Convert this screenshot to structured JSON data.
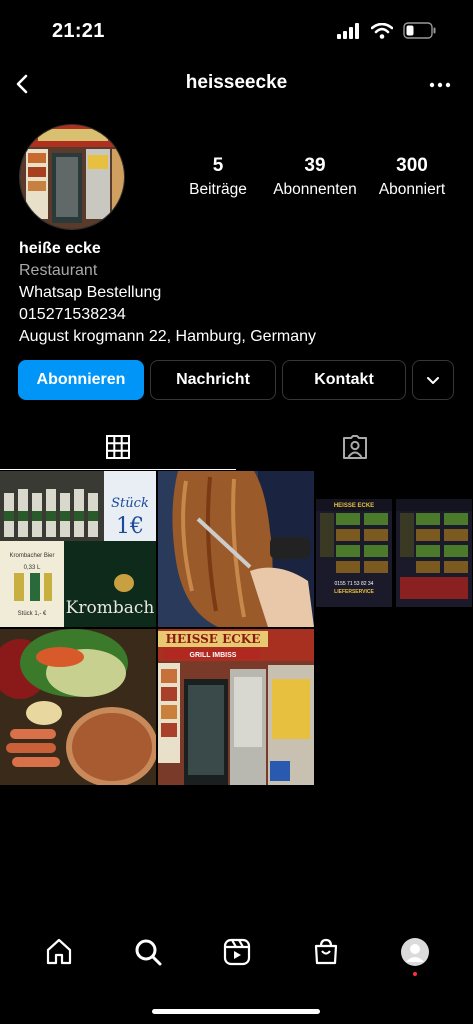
{
  "status": {
    "time": "21:21"
  },
  "header": {
    "username": "heisseecke"
  },
  "stats": [
    {
      "num": "5",
      "label": "Beiträge"
    },
    {
      "num": "39",
      "label": "Abonnenten"
    },
    {
      "num": "300",
      "label": "Abonniert"
    }
  ],
  "bio": {
    "name": "heiße ecke",
    "category": "Restaurant",
    "lines": [
      "Whatsap Bestellung",
      "015271538234",
      "August krogmann 22, Hamburg, Germany"
    ]
  },
  "buttons": {
    "follow": "Abonnieren",
    "message": "Nachricht",
    "contact": "Kontakt"
  },
  "posts": {
    "p1_sign": "Stück\n1€",
    "p1_brand": "Krombach",
    "p1_menu": "Krombacher Bier",
    "p1_price": "0,33 L",
    "p1_price2": "Stück 1,- €",
    "p3_title": "HEISSE ECKE",
    "p3_sub": "GRILL IMBISS",
    "p3_delivery": "LIEFERSERVICE",
    "p3_phone": "0155 71 53 82 34",
    "p5_title": "HEISSE ECKE",
    "p5_sub": "GRILL IMBISS"
  },
  "colors": {
    "accent": "#0095f6",
    "border": "#363636",
    "muted": "#a8a8a8",
    "notify": "#ff3040"
  }
}
